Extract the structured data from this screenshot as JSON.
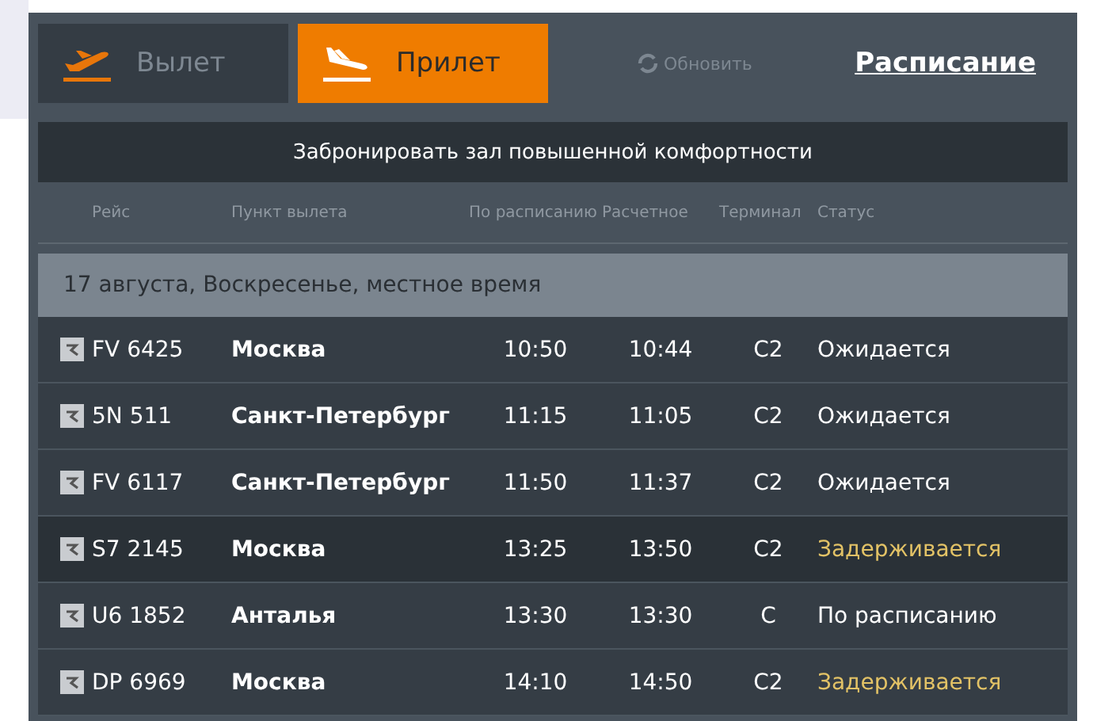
{
  "tabs": [
    {
      "label": "Вылет",
      "kind": "departure",
      "selected": false
    },
    {
      "label": "Прилет",
      "kind": "arrival",
      "selected": true
    }
  ],
  "refresh": {
    "label": "Обновить"
  },
  "schedule_link": "Расписание",
  "booking_bar": "Забронировать зал повышенной комфортности",
  "table": {
    "columns": [
      "Рейс",
      "Пункт вылета",
      "По расписанию",
      "Расчетное",
      "Терминал",
      "Статус"
    ],
    "date_row": "17 августа, Воскресенье, местное время",
    "rows": [
      {
        "flight": "FV 6425",
        "city": "Москва",
        "scheduled": "10:50",
        "estimated": "10:44",
        "terminal": "C2",
        "status": "Ожидается",
        "delayed": false,
        "selected": false
      },
      {
        "flight": "5N 511",
        "city": "Санкт-Петербург",
        "scheduled": "11:15",
        "estimated": "11:05",
        "terminal": "C2",
        "status": "Ожидается",
        "delayed": false,
        "selected": false
      },
      {
        "flight": "FV 6117",
        "city": "Санкт-Петербург",
        "scheduled": "11:50",
        "estimated": "11:37",
        "terminal": "C2",
        "status": "Ожидается",
        "delayed": false,
        "selected": false
      },
      {
        "flight": "S7 2145",
        "city": "Москва",
        "scheduled": "13:25",
        "estimated": "13:50",
        "terminal": "C2",
        "status": "Задерживается",
        "delayed": true,
        "selected": true
      },
      {
        "flight": "U6 1852",
        "city": "Анталья",
        "scheduled": "13:30",
        "estimated": "13:30",
        "terminal": "C",
        "status": "По расписанию",
        "delayed": false,
        "selected": false
      },
      {
        "flight": "DP 6969",
        "city": "Москва",
        "scheduled": "14:10",
        "estimated": "14:50",
        "terminal": "C2",
        "status": "Задерживается",
        "delayed": true,
        "selected": false
      }
    ]
  }
}
